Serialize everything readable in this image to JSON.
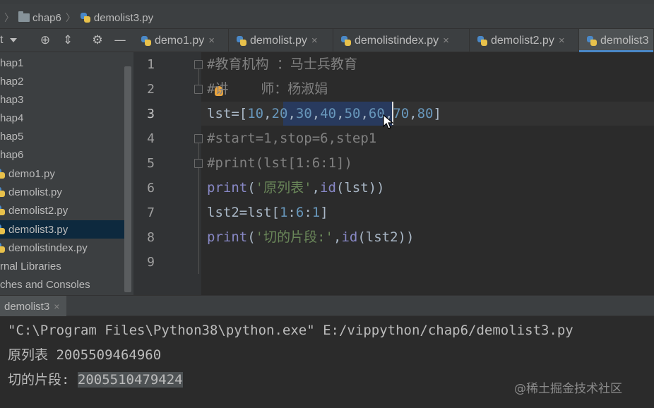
{
  "breadcrumb": {
    "folder": "chap6",
    "file": "demolist3.py"
  },
  "project_panel": {
    "label": "t"
  },
  "tabs": [
    {
      "label": "demo1.py"
    },
    {
      "label": "demolist.py"
    },
    {
      "label": "demolistindex.py"
    },
    {
      "label": "demolist2.py"
    },
    {
      "label": "demolist3"
    }
  ],
  "tree": [
    {
      "label": "hap1"
    },
    {
      "label": "hap2"
    },
    {
      "label": "hap3"
    },
    {
      "label": "hap4"
    },
    {
      "label": "hap5"
    },
    {
      "label": "hap6"
    },
    {
      "label": "demo1.py"
    },
    {
      "label": "demolist.py"
    },
    {
      "label": "demolist2.py"
    },
    {
      "label": "demolist3.py"
    },
    {
      "label": "demolistindex.py"
    },
    {
      "label": "rnal Libraries"
    },
    {
      "label": "ches and Consoles"
    }
  ],
  "line_numbers": [
    "1",
    "2",
    "3",
    "4",
    "5",
    "6",
    "7",
    "8",
    "9"
  ],
  "code": {
    "l1": "#教育机构 ：马士兵教育",
    "l2": "#讲    师：杨淑娟",
    "l3": {
      "a": "lst=[",
      "n1": "10",
      "c1": ",",
      "n2": "20",
      "c2": ",",
      "n3": "30",
      "c3": ",",
      "n4": "40",
      "c4": ",",
      "n5": "50",
      "c5": ",",
      "n6": "60",
      "c6": ",",
      "n7": "70",
      "c7": ",",
      "n8": "80",
      "z": "]"
    },
    "l4": "#start=1,stop=6,step1",
    "l5": "#print(lst[1:6:1])",
    "l6": {
      "fn": "print",
      "p1": "(",
      "s": "'原列表'",
      "c": ",",
      "fn2": "id",
      "rest": "(lst))"
    },
    "l7": {
      "a": "lst2=lst[",
      "n1": "1",
      "c1": ":",
      "n2": "6",
      "c2": ":",
      "n3": "1",
      "z": "]"
    },
    "l8": {
      "fn": "print",
      "p1": "(",
      "s": "'切的片段:'",
      "c": ",",
      "fn2": "id",
      "rest": "(lst2))"
    }
  },
  "run": {
    "tab": "demolist3",
    "lines": [
      "\"C:\\Program Files\\Python38\\python.exe\" E:/vippython/chap6/demolist3.py",
      "原列表 2005509464960"
    ],
    "last_prefix": "切的片段: ",
    "last_value": "2005510479424"
  },
  "watermark": "@稀土掘金技术社区",
  "colors": {
    "comment": "#808080",
    "number": "#6897bb",
    "builtin": "#8888c6",
    "string": "#6a8759",
    "text": "#a9b7c6"
  }
}
